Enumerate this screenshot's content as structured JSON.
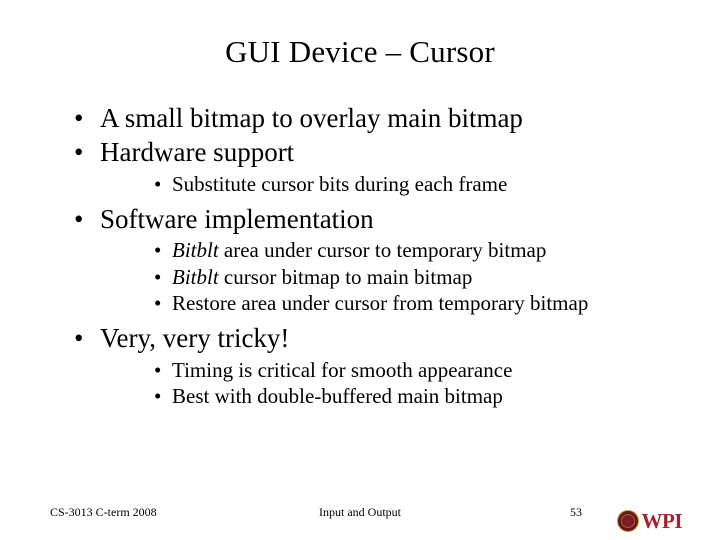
{
  "title": "GUI Device – Cursor",
  "bullets": {
    "b1": "A small bitmap to overlay main bitmap",
    "b2": "Hardware support",
    "b2_1": "Substitute cursor bits during each frame",
    "b3": "Software implementation",
    "b3_1_prefix": "Bitblt",
    "b3_1_rest": " area under cursor to temporary bitmap",
    "b3_2_prefix": "Bitblt",
    "b3_2_rest": " cursor bitmap to main bitmap",
    "b3_3": "Restore area under cursor from temporary bitmap",
    "b4": "Very, very tricky!",
    "b4_1": "Timing is critical for smooth appearance",
    "b4_2": "Best with double-buffered main bitmap"
  },
  "footer": {
    "left": "CS-3013 C-term 2008",
    "center": "Input and Output",
    "page": "53",
    "logo_text": "WPI"
  }
}
